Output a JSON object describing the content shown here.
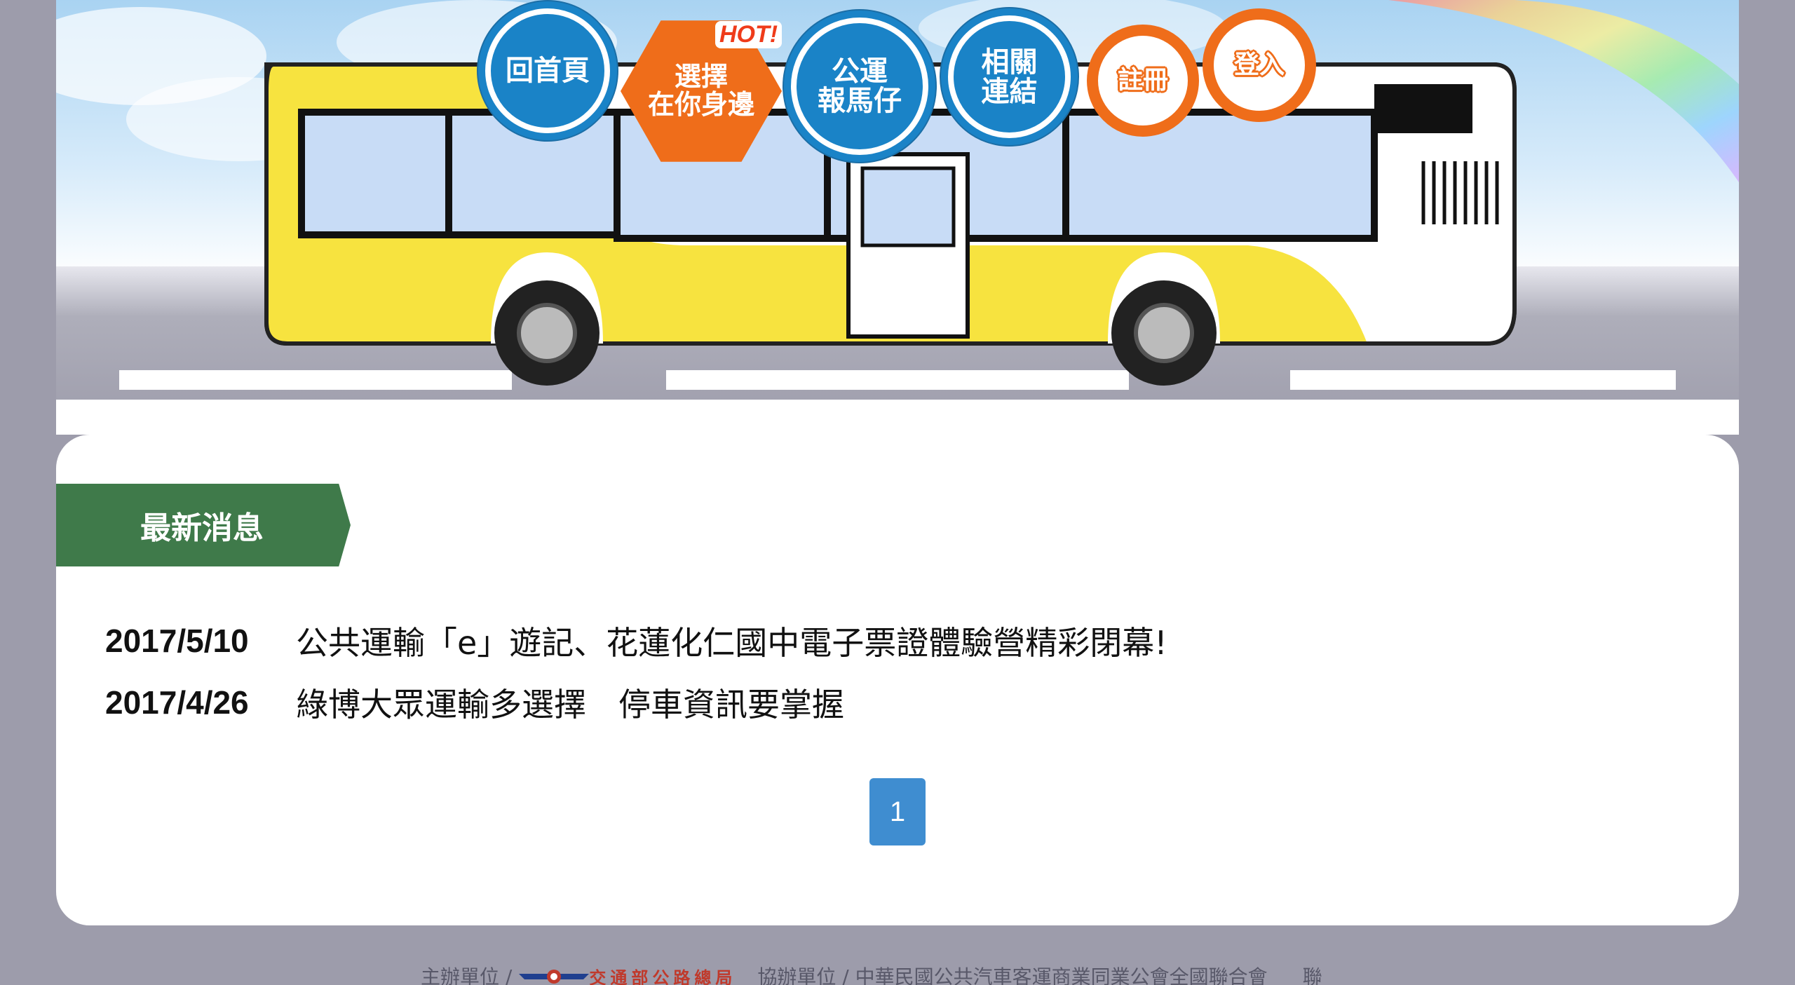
{
  "nav": {
    "home": "回首頁",
    "choose_line1": "選擇",
    "choose_line2": "在你身邊",
    "hot": "HOT!",
    "reporter_line1": "公運",
    "reporter_line2": "報馬仔",
    "links_line1": "相關",
    "links_line2": "連結",
    "register": "註冊",
    "login": "登入"
  },
  "news": {
    "heading": "最新消息",
    "items": [
      {
        "date": "2017/5/10",
        "title": "公共運輸「e」遊記、花蓮化仁國中電子票證體驗營精彩閉幕!"
      },
      {
        "date": "2017/4/26",
        "title": "綠博大眾運輸多選擇　停車資訊要掌握"
      }
    ]
  },
  "pagination": {
    "current": "1"
  },
  "footer": {
    "organizer_label": "主辦單位 /",
    "organizer_logo_text": "交通部公路總局",
    "co_organizer_label": "協辦單位 / 中華民國公共汽車客運商業同業公會全國聯合會",
    "trailing": "聯"
  },
  "colors": {
    "background": "#9d9cab",
    "nav_blue": "#1a83c7",
    "nav_orange": "#ef6d1a",
    "section_green": "#3f7a4a",
    "page_blue": "#3f8dd0",
    "bus_yellow": "#f7e33f"
  }
}
